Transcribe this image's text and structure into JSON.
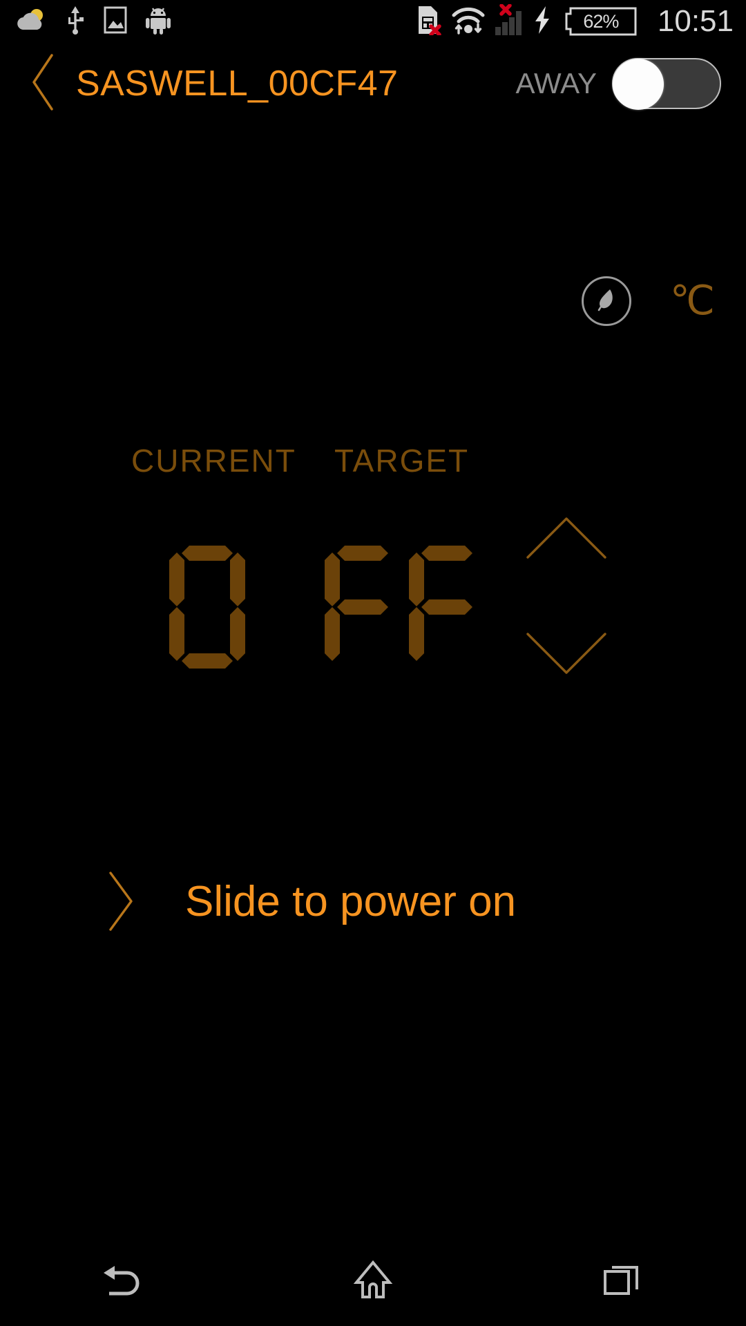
{
  "status_bar": {
    "left_icons": [
      {
        "name": "weather-cloud-sun-icon",
        "label": "Weather"
      },
      {
        "name": "usb-icon",
        "label": "USB connected"
      },
      {
        "name": "screenshot-image-icon",
        "label": "Screenshot captured"
      },
      {
        "name": "android-system-icon",
        "label": "Android system"
      }
    ],
    "right_icons": [
      {
        "name": "sim-card-error-icon",
        "label": "No SIM card"
      },
      {
        "name": "wifi-transfer-icon",
        "label": "Wi-Fi connected"
      },
      {
        "name": "cellular-signal-error-icon",
        "label": "No mobile service"
      },
      {
        "name": "charging-bolt-icon",
        "label": "Charging"
      }
    ],
    "battery_level": "62%",
    "clock": "10:51"
  },
  "header": {
    "back_icon": "chevron-left-icon",
    "title": "SASWELL_00CF47",
    "away_label": "AWAY",
    "away_state": "off"
  },
  "controls": {
    "eco_icon": "eco-leaf-icon",
    "temperature_unit": "℃"
  },
  "readouts": {
    "current_label": "CURRENT",
    "target_label": "TARGET",
    "current_value": "0",
    "target_value": "FF",
    "current_segments": [
      "0"
    ],
    "target_segments": [
      "F",
      "F"
    ]
  },
  "stepper": {
    "up_icon": "chevron-up-icon",
    "down_icon": "chevron-down-icon"
  },
  "slider": {
    "chevron_icon": "chevron-right-icon",
    "text": "Slide to power on"
  },
  "navbar": {
    "back": {
      "icon": "nav-back-icon",
      "label": "Back"
    },
    "home": {
      "icon": "nav-home-icon",
      "label": "Home"
    },
    "recents": {
      "icon": "nav-recents-icon",
      "label": "Recent apps"
    }
  },
  "colors": {
    "background": "#000000",
    "accent_orange": "#F79421",
    "dim_amber": "#7A4D0B",
    "segment_on": "#6B4209",
    "status_text": "#D8D8D8",
    "muted_grey": "#8C8C8C",
    "error_red": "#D0021B"
  }
}
